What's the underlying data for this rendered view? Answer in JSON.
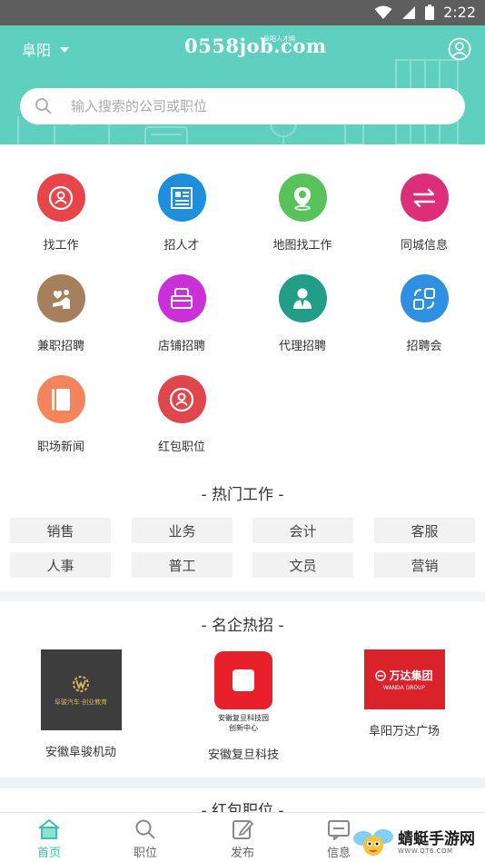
{
  "status_bar": {
    "time": "2:22"
  },
  "header": {
    "city": "阜阳",
    "logo_main": "0558job.com",
    "logo_sub": "阜阳人才网",
    "search_placeholder": "输入搜索的公司或职位"
  },
  "grid": [
    {
      "label": "找工作",
      "icon": "person-circle-icon",
      "color": "#e8454b"
    },
    {
      "label": "招人才",
      "icon": "document-list-icon",
      "color": "#1f8fdc"
    },
    {
      "label": "地图找工作",
      "icon": "map-pin-icon",
      "color": "#57c35a"
    },
    {
      "label": "同城信息",
      "icon": "swap-arrows-icon",
      "color": "#dd2e7a"
    },
    {
      "label": "兼职招聘",
      "icon": "heart-person-icon",
      "color": "#a67f5d"
    },
    {
      "label": "店铺招聘",
      "icon": "shop-icon",
      "color": "#c930d8"
    },
    {
      "label": "代理招聘",
      "icon": "agent-person-icon",
      "color": "#229d86"
    },
    {
      "label": "招聘会",
      "icon": "exchange-squares-icon",
      "color": "#2f8fe0"
    },
    {
      "label": "职场新闻",
      "icon": "book-icon",
      "color": "#f4845d"
    },
    {
      "label": "红包职位",
      "icon": "red-packet-person-icon",
      "color": "#e0474d"
    }
  ],
  "hot_jobs": {
    "title": "- 热门工作 -",
    "tags": [
      "销售",
      "业务",
      "会计",
      "客服",
      "人事",
      "普工",
      "文员",
      "营销"
    ]
  },
  "companies": {
    "title": "- 名企热招 -",
    "items": [
      {
        "name": "安徽阜骏机动",
        "logo_text": "阜骏汽车·创业教育"
      },
      {
        "name": "安徽复旦科技",
        "logo_text_1": "安徽复旦科技园",
        "logo_text_2": "创新中心"
      },
      {
        "name": "阜阳万达广场",
        "logo_text": "万达集团",
        "logo_sub": "WANDA GROUP"
      }
    ]
  },
  "red_jobs": {
    "title": "- 红包职位 -"
  },
  "tabbar": [
    {
      "label": "首页",
      "active": true
    },
    {
      "label": "职位",
      "active": false
    },
    {
      "label": "发布",
      "active": false
    },
    {
      "label": "信息",
      "active": false
    }
  ],
  "watermark": {
    "text": "蜻蜓手游网",
    "url": "WWW.QT6.COM"
  }
}
